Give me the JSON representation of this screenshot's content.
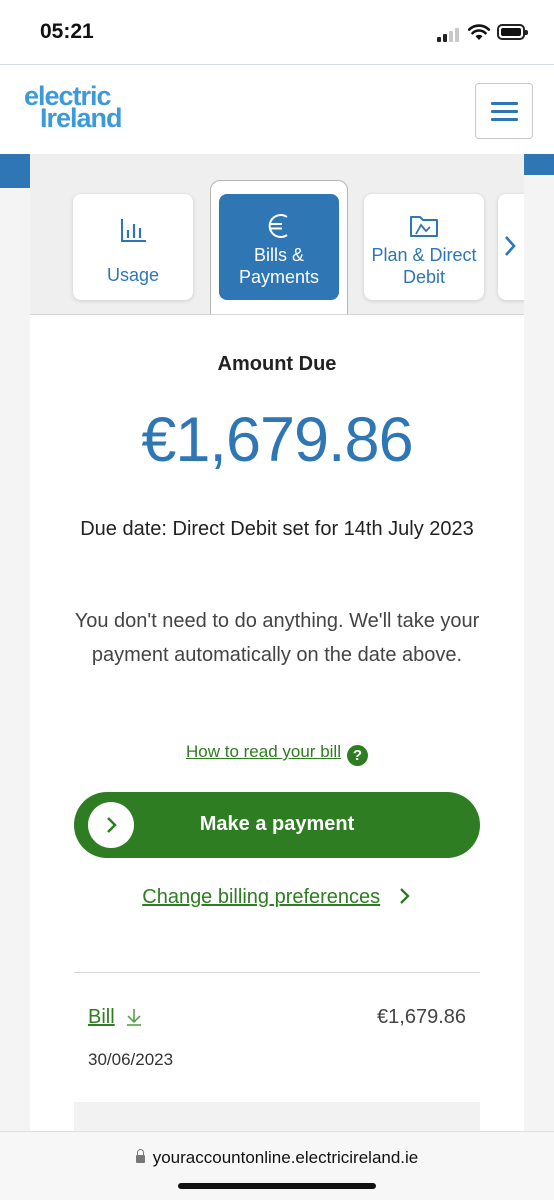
{
  "status_bar": {
    "time": "05:21"
  },
  "header": {
    "logo_line1": "electric",
    "logo_line2": "Ireland",
    "brand_color": "#3d9ad8",
    "menu_icon": "hamburger-menu-icon"
  },
  "tabs": [
    {
      "icon": "chart-icon",
      "label": "Usage",
      "active": false
    },
    {
      "icon": "euro-icon",
      "label": "Bills & Payments",
      "active": true
    },
    {
      "icon": "folder-icon",
      "label": "Plan & Direct Debit",
      "active": false
    }
  ],
  "main": {
    "amount_title": "Amount Due",
    "amount": "€1,679.86",
    "due_date": "Due date: Direct Debit set for 14th July 2023",
    "info_line1": "You don't need to do anything. We'll take your",
    "info_line2": "payment automatically on the date above.",
    "how_to_read": "How to read your bill",
    "make_payment": "Make a payment",
    "change_billing": "Change billing preferences"
  },
  "bills": [
    {
      "label": "Bill",
      "amount": "€1,679.86",
      "date": "30/06/2023"
    }
  ],
  "browser": {
    "url": "youraccountonline.electricireland.ie"
  },
  "colors": {
    "primary_blue": "#2f76b5",
    "action_green": "#2e7d22"
  }
}
